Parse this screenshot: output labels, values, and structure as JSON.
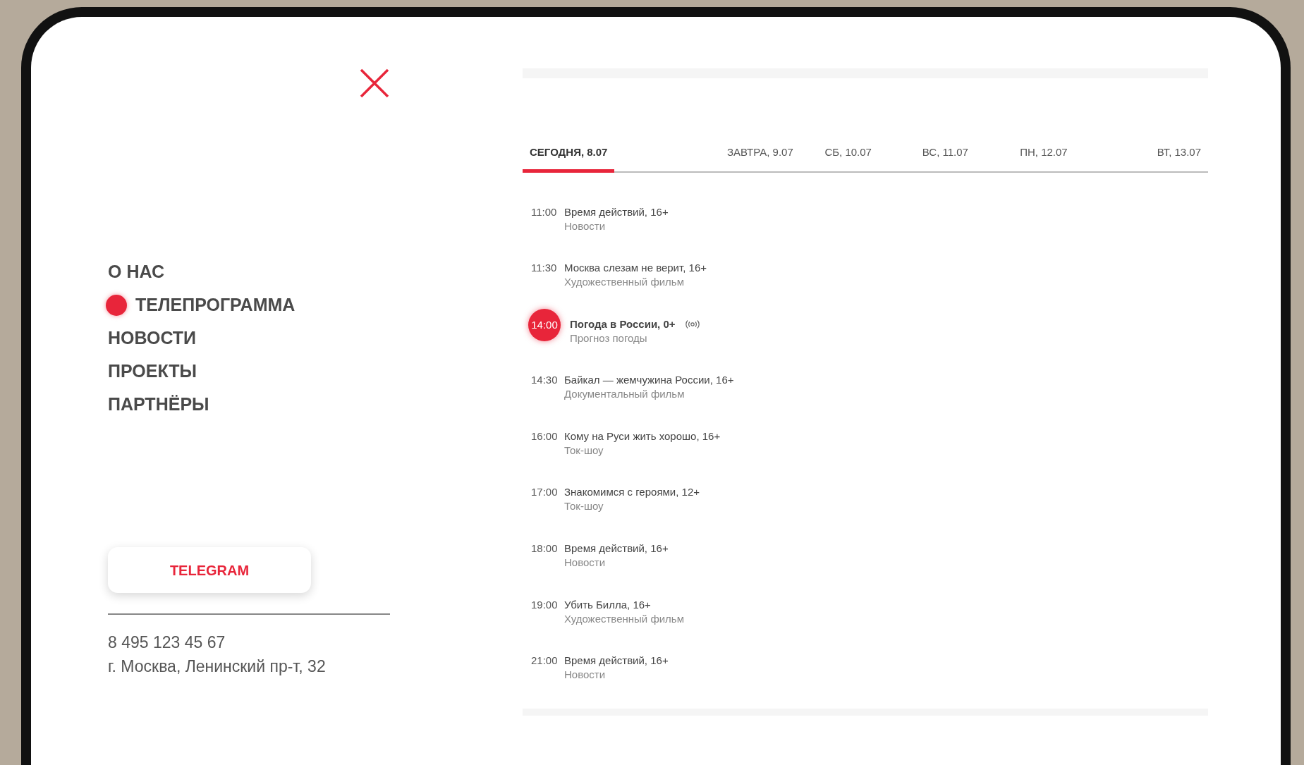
{
  "menu": [
    {
      "label": "О НАС",
      "selected": false
    },
    {
      "label": "ТЕЛЕПРОГРАММА",
      "selected": true
    },
    {
      "label": "НОВОСТИ",
      "selected": false
    },
    {
      "label": "ПРОЕКТЫ",
      "selected": false
    },
    {
      "label": "ПАРТНЁРЫ",
      "selected": false
    }
  ],
  "telegram_button": "TELEGRAM",
  "contacts": {
    "phone": "8 495 123 45 67",
    "address": "г. Москва, Ленинский пр-т, 32"
  },
  "schedule": {
    "tabs": [
      {
        "label": "СЕГОДНЯ, 8.07",
        "selected": true
      },
      {
        "label": "ЗАВТРА, 9.07",
        "selected": false
      },
      {
        "label": "СБ, 10.07",
        "selected": false
      },
      {
        "label": "ВС, 11.07",
        "selected": false
      },
      {
        "label": "ПН, 12.07",
        "selected": false
      },
      {
        "label": "ВТ, 13.07",
        "selected": false
      }
    ],
    "programs": [
      {
        "time": "11:00",
        "title": "Время действий, 16+",
        "genre": "Новости",
        "live": false
      },
      {
        "time": "11:30",
        "title": "Москва слезам не верит, 16+",
        "genre": "Художественный фильм",
        "live": false
      },
      {
        "time": "14:00",
        "title": "Погода в России, 0+",
        "genre": "Прогноз погоды",
        "live": true
      },
      {
        "time": "14:30",
        "title": "Байкал — жемчужина России, 16+",
        "genre": "Документальный фильм",
        "live": false
      },
      {
        "time": "16:00",
        "title": "Кому на Руси жить хорошо, 16+",
        "genre": "Ток-шоу",
        "live": false
      },
      {
        "time": "17:00",
        "title": "Знакомимся с героями, 12+",
        "genre": "Ток-шоу",
        "live": false
      },
      {
        "time": "18:00",
        "title": "Время действий, 16+",
        "genre": "Новости",
        "live": false
      },
      {
        "time": "19:00",
        "title": "Убить Билла, 16+",
        "genre": "Художественный фильм",
        "live": false
      },
      {
        "time": "21:00",
        "title": "Время действий, 16+",
        "genre": "Новости",
        "live": false
      }
    ]
  }
}
